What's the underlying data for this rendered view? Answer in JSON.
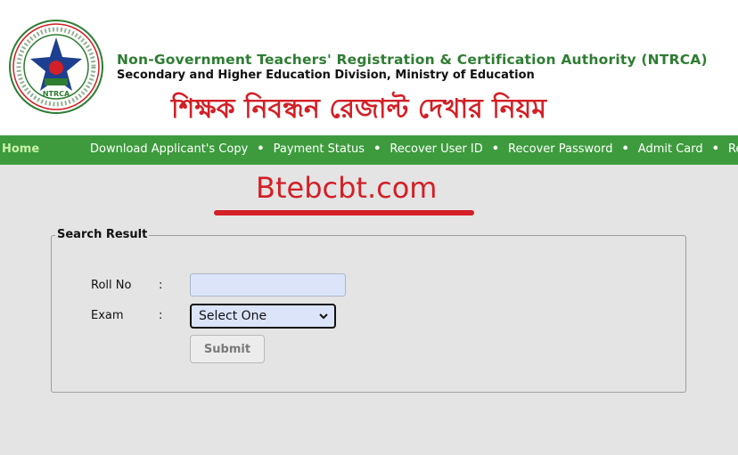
{
  "header": {
    "org_title": "Non-Government Teachers' Registration & Certification Authority (NTRCA)",
    "org_subtitle": "Secondary and Higher Education Division, Ministry of Education",
    "bangla_title": "শিক্ষক নিবন্ধন রেজাল্ট দেখার নিয়ম",
    "logo_text": "NTRCA"
  },
  "nav": {
    "home": "Home",
    "items": [
      "Download Applicant's Copy",
      "Payment Status",
      "Recover User ID",
      "Recover Password",
      "Admit Card",
      "Results"
    ],
    "separator": "•"
  },
  "watermark": {
    "text": "Btebcbt.com"
  },
  "search": {
    "legend": "Search Result",
    "roll_label": "Roll No",
    "exam_label": "Exam",
    "colon": ":",
    "roll_value": "",
    "exam_selected": "Select One",
    "submit_label": "Submit"
  },
  "colors": {
    "nav_bg": "#3d9b3d",
    "title_green": "#2e7d32",
    "accent_red": "#d31f26",
    "page_bg": "#e4e4e4",
    "input_bg": "#dbe4f9"
  }
}
